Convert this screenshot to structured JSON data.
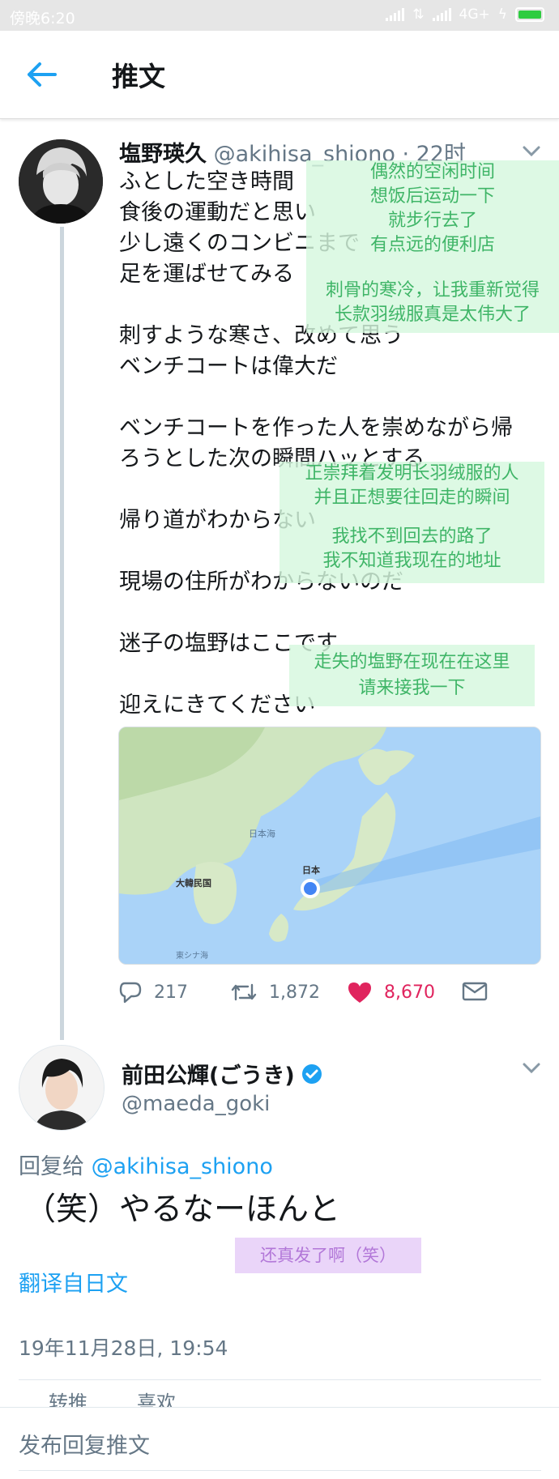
{
  "status_bar": {
    "time": "傍晚6:20",
    "network": "4G+"
  },
  "header": {
    "title": "推文"
  },
  "tweet1": {
    "name": "塩野瑛久",
    "handle": "@akihisa_shiono",
    "separator": "·",
    "time": "22时",
    "lines": [
      "ふとした空き時間",
      "食後の運動だと思い",
      "少し遠くのコンビニまで",
      "足を運ばせてみる",
      "",
      "刺すような寒さ、改めて思う",
      "ベンチコートは偉大だ",
      "",
      "ベンチコートを作った人を崇めながら帰",
      "ろうとした次の瞬間ハッとする",
      "",
      "帰り道がわからない",
      "",
      "現場の住所がわからないのだ",
      "",
      "迷子の塩野はここです",
      "",
      "迎えにきてください"
    ],
    "map": {
      "sea": "日本海",
      "korea": "大韓民国",
      "japan": "日本",
      "east_china_sea": "東シナ海"
    },
    "actions": {
      "replies": "217",
      "retweets": "1,872",
      "likes": "8,670"
    }
  },
  "translations": {
    "t1": [
      "偶然的空闲时间",
      "想饭后运动一下",
      "就步行去了",
      "有点远的便利店"
    ],
    "t2": [
      "刺骨的寒冷，让我重新觉得",
      "长款羽绒服真是太伟大了"
    ],
    "t3": [
      "正崇拜着发明长羽绒服的人",
      "并且正想要往回走的瞬间"
    ],
    "t4": [
      "我找不到回去的路了",
      "我不知道我现在的地址"
    ],
    "t5": [
      "走失的塩野在现在在这里",
      "请来接我一下"
    ],
    "t6": "还真发了啊（笑）"
  },
  "tweet2": {
    "name": "前田公輝(ごうき)",
    "handle": "@maeda_goki",
    "reply_prefix": "回复给",
    "reply_handle": "@akihisa_shiono",
    "text": "（笑）やるなーほんと",
    "translate": "翻译自日文",
    "timestamp": "19年11月28日, 19:54",
    "stats_peek": "转推        喜欢"
  },
  "compose": {
    "placeholder": "发布回复推文"
  },
  "colors": {
    "link": "#1da1f2",
    "like": "#e0245e",
    "muted": "#657786",
    "translation_text": "#3fb567"
  }
}
